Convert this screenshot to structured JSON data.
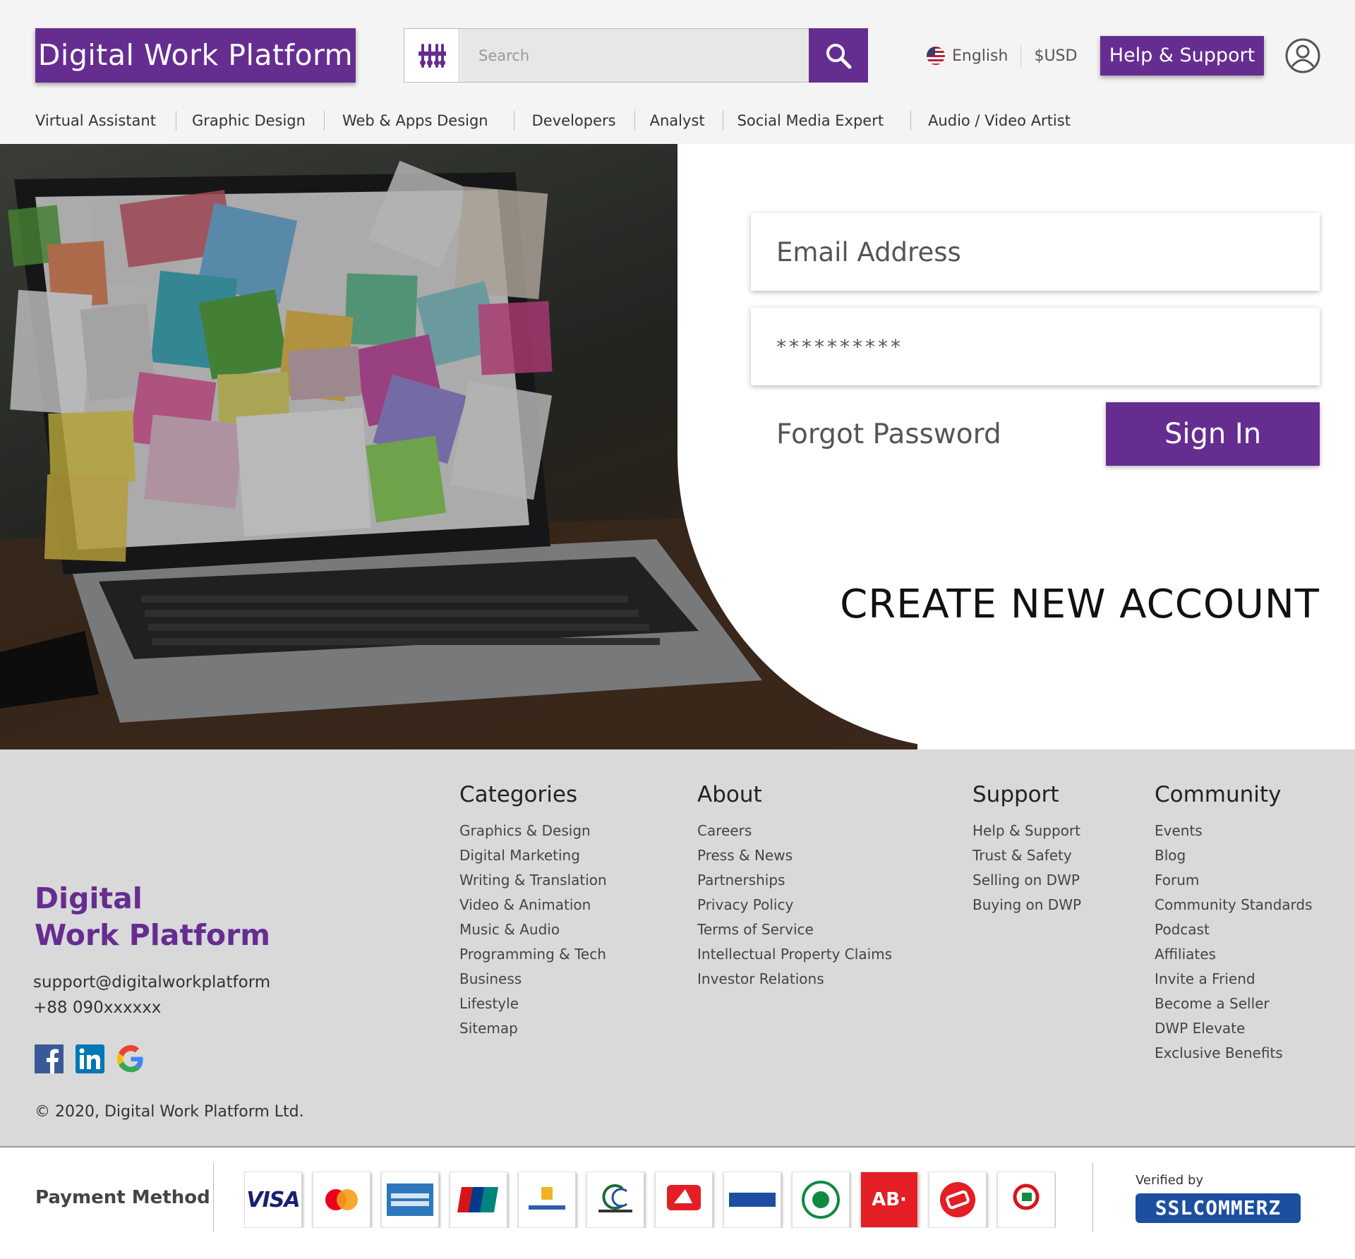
{
  "header": {
    "logo": "Digital Work Platform",
    "search_placeholder": "Search",
    "language": "English",
    "currency": "$USD",
    "help_button": "Help & Support"
  },
  "nav": [
    "Virtual Assistant",
    "Graphic Design",
    "Web & Apps Design",
    "Developers",
    "Analyst",
    "Social Media Expert",
    "Audio / Video Artist"
  ],
  "login": {
    "email_placeholder": "Email Address",
    "password_value": "**********",
    "forgot": "Forgot Password",
    "signin": "Sign In",
    "create": "CREATE NEW ACCOUNT"
  },
  "footer": {
    "logo_line1": "Digital",
    "logo_line2": "Work Platform",
    "email": "support@digitalworkplatform",
    "phone": "+88 090xxxxxx",
    "copyright": "© 2020, Digital Work Platform Ltd.",
    "columns": [
      {
        "title": "Categories",
        "links": [
          "Graphics & Design",
          "Digital Marketing",
          "Writing & Translation",
          "Video & Animation",
          "Music & Audio",
          "Programming & Tech",
          "Business",
          "Lifestyle",
          "Sitemap"
        ]
      },
      {
        "title": "About",
        "links": [
          "Careers",
          "Press & News",
          "Partnerships",
          "Privacy Policy",
          "Terms of Service",
          "Intellectual Property Claims",
          "Investor Relations"
        ]
      },
      {
        "title": "Support",
        "links": [
          "Help & Support",
          "Trust & Safety",
          "Selling on DWP",
          "Buying on DWP"
        ]
      },
      {
        "title": "Community",
        "links": [
          "Events",
          "Blog",
          "Forum",
          "Community Standards",
          "Podcast",
          "Affiliates",
          "Invite a Friend",
          "Become a Seller",
          "DWP Elevate",
          "Exclusive Benefits"
        ]
      }
    ]
  },
  "payment": {
    "label": "Payment Method",
    "cards": [
      {
        "name": "visa-logo",
        "text": "VISA",
        "color": "#1a1f71"
      },
      {
        "name": "mastercard-logo",
        "text": "",
        "color": "#eb001b"
      },
      {
        "name": "amex-logo",
        "text": "",
        "color": "#2e77bc"
      },
      {
        "name": "unionpay-logo",
        "text": "",
        "color": "#d7141a"
      },
      {
        "name": "brac-bank-logo",
        "text": "",
        "color": "#2f5fa7"
      },
      {
        "name": "dbbl-nexus-logo",
        "text": "",
        "color": "#1b6b3a"
      },
      {
        "name": "citytouch-logo",
        "text": "",
        "color": "#e31e24"
      },
      {
        "name": "bank-asia-logo",
        "text": "",
        "color": "#1c4fa0"
      },
      {
        "name": "islami-bank-logo",
        "text": "",
        "color": "#118a3f"
      },
      {
        "name": "ab-bank-logo",
        "text": "AB·",
        "color": "#e31e24"
      },
      {
        "name": "q-cash-logo",
        "text": "",
        "color": "#e31e24"
      },
      {
        "name": "fastcash-logo",
        "text": "",
        "color": "#d7141a"
      }
    ],
    "verified_by": "Verified by",
    "ssl": "SSLCOMMERZ"
  },
  "colors": {
    "brand": "#662d91",
    "footer_bg": "#d9d9d9",
    "header_bg": "#f4f4f4"
  }
}
